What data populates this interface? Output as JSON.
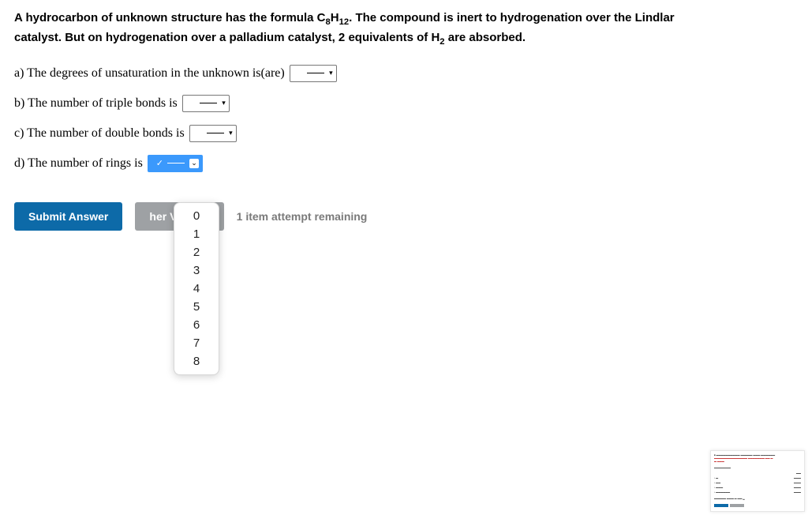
{
  "problem": {
    "line1_pre": "A hydrocarbon of unknown structure has the formula C",
    "line1_sub1": "8",
    "line1_mid": "H",
    "line1_sub2": "12",
    "line1_post": ". The compound is inert to hydrogenation over the Lindlar",
    "line2_pre": "catalyst. But on hydrogenation over a palladium catalyst, 2 equivalents of H",
    "line2_sub": "2",
    "line2_post": " are absorbed."
  },
  "questions": {
    "a": "a) The degrees of unsaturation in the unknown is(are)",
    "b": "b) The number of triple bonds is",
    "c": "c) The number of double bonds is",
    "d": "d) The number of rings is"
  },
  "dropdown": {
    "options": [
      "0",
      "1",
      "2",
      "3",
      "4",
      "5",
      "6",
      "7",
      "8"
    ]
  },
  "actions": {
    "submit": "Submit Answer",
    "another": "her Version",
    "attempts": "1 item attempt remaining"
  }
}
